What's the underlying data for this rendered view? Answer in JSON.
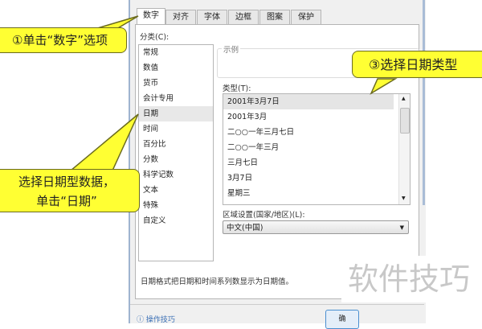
{
  "tabs": [
    "数字",
    "对齐",
    "字体",
    "边框",
    "图案",
    "保护"
  ],
  "category_label": "分类(C):",
  "categories": [
    "常规",
    "数值",
    "货币",
    "会计专用",
    "日期",
    "时间",
    "百分比",
    "分数",
    "科学记数",
    "文本",
    "特殊",
    "自定义"
  ],
  "sample_label": "示例",
  "type_label": "类型(T):",
  "types": [
    "2001年3月7日",
    "2001年3月",
    "二○○一年三月七日",
    "二○○一年三月",
    "三月七日",
    "3月7日",
    "星期三"
  ],
  "region_label": "区域设置(国家/地区)(L):",
  "region_value": "中文(中国)",
  "description": "日期格式把日期和时间系列数显示为日期值。",
  "tips_link": "操作技巧",
  "ok_button": "确",
  "callouts": {
    "c1": "①单击“数字”选项",
    "c2a": "选择日期型数据，",
    "c2b": "单击“日期”",
    "c3": "③选择日期类型"
  },
  "watermark": "软件技巧"
}
